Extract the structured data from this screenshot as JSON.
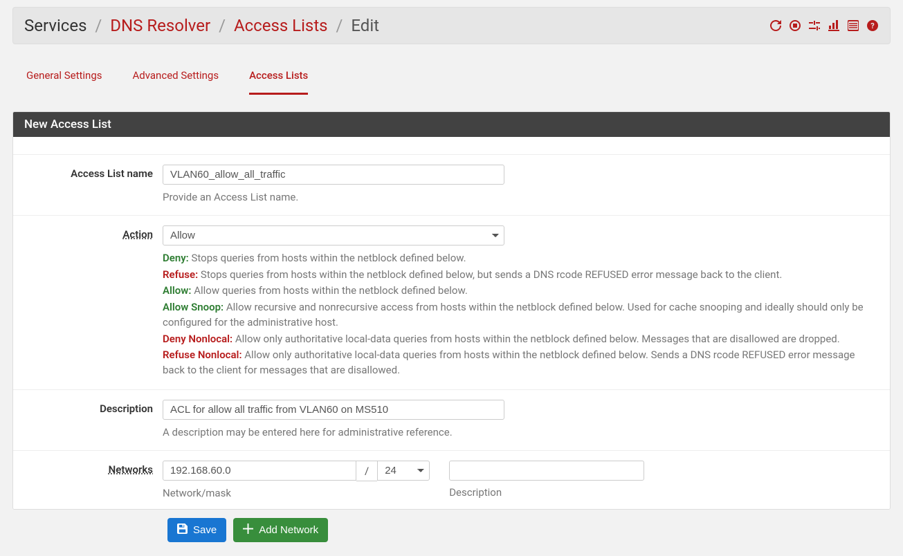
{
  "breadcrumb": {
    "items": [
      "Services",
      "DNS Resolver",
      "Access Lists",
      "Edit"
    ]
  },
  "tabs": {
    "items": [
      {
        "label": "General Settings",
        "active": false
      },
      {
        "label": "Advanced Settings",
        "active": false
      },
      {
        "label": "Access Lists",
        "active": true
      }
    ]
  },
  "panel": {
    "heading": "New Access List"
  },
  "form": {
    "name": {
      "label": "Access List name",
      "value": "VLAN60_allow_all_traffic",
      "help": "Provide an Access List name."
    },
    "action": {
      "label": "Action",
      "value": "Allow",
      "descriptions": [
        {
          "term": "Deny:",
          "color": "green",
          "text": " Stops queries from hosts within the netblock defined below."
        },
        {
          "term": "Refuse:",
          "color": "red",
          "text": " Stops queries from hosts within the netblock defined below, but sends a DNS rcode REFUSED error message back to the client."
        },
        {
          "term": "Allow:",
          "color": "green",
          "text": " Allow queries from hosts within the netblock defined below."
        },
        {
          "term": "Allow Snoop:",
          "color": "green",
          "text": " Allow recursive and nonrecursive access from hosts within the netblock defined below. Used for cache snooping and ideally should only be configured for the administrative host."
        },
        {
          "term": "Deny Nonlocal:",
          "color": "red",
          "text": " Allow only authoritative local-data queries from hosts within the netblock defined below. Messages that are disallowed are dropped."
        },
        {
          "term": "Refuse Nonlocal:",
          "color": "red",
          "text": " Allow only authoritative local-data queries from hosts within the netblock defined below. Sends a DNS rcode REFUSED error message back to the client for messages that are disallowed."
        }
      ]
    },
    "description": {
      "label": "Description",
      "value": "ACL for allow all traffic from VLAN60 on MS510",
      "help": "A description may be entered here for administrative reference."
    },
    "networks": {
      "label": "Networks",
      "rows": [
        {
          "network": "192.168.60.0",
          "slash": "/",
          "mask": "24",
          "description": ""
        }
      ],
      "sublabel_network": "Network/mask",
      "sublabel_description": "Description"
    }
  },
  "buttons": {
    "save": "Save",
    "add_network": "Add Network"
  }
}
